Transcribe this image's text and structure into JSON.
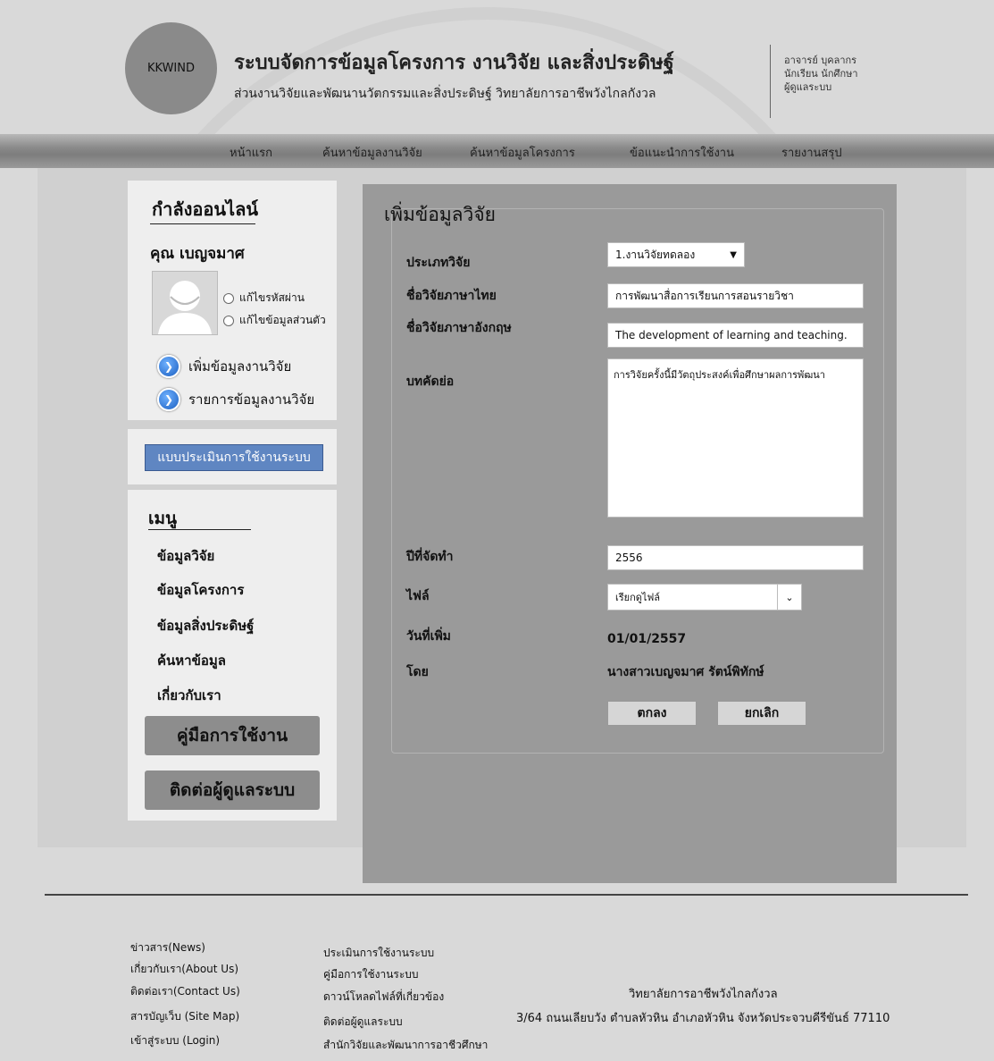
{
  "header": {
    "logo_text": "KKWIND",
    "title": "ระบบจัดการข้อมูลโครงการ งานวิจัย และสิ่งประดิษฐ์",
    "subtitle": "ส่วนงานวิจัยและพัฒนานวัตกรรมและสิ่งประดิษฐ์ วิทยาลัยการอาชีพวังไกลกังวล",
    "roles": [
      "อาจารย์ บุคลากร",
      "นักเรียน นักศึกษา",
      "ผู้ดูแลระบบ"
    ]
  },
  "nav": {
    "items": [
      "หน้าแรก",
      "ค้นหาข้อมูลงานวิจัย",
      "ค้นหาข้อมูลโครงการ",
      "ข้อแนะนำการใช้งาน",
      "รายงานสรุป"
    ]
  },
  "sidebar": {
    "online_title": "กำลังออนไลน์",
    "user_name": "คุณ เบญจมาศ",
    "account_links": [
      "แก้ไขรหัสผ่าน",
      "แก้ไขข้อมูลส่วนตัว"
    ],
    "research_links": [
      "เพิ่มข้อมูลงานวิจัย",
      "รายการข้อมูลงานวิจัย"
    ],
    "evaluation_button": "แบบประเมินการใช้งานระบบ",
    "menu_title": "เมนู",
    "menu_items": [
      "ข้อมูลวิจัย",
      "ข้อมูลโครงการ",
      "ข้อมูลสิ่งประดิษฐ์",
      "ค้นหาข้อมูล",
      "เกี่ยวกับเรา"
    ],
    "manual_button": "คู่มือการใช้งาน",
    "contact_button": "ติดต่อผู้ดูแลระบบ"
  },
  "form": {
    "title": "เพิ่มข้อมูลวิจัย",
    "labels": {
      "type": "ประเภทวิจัย",
      "name_th": "ชื่อวิจัยภาษาไทย",
      "name_en": "ชื่อวิจัยภาษาอังกฤษ",
      "abstract": "บทคัดย่อ",
      "year": "ปีที่จัดทำ",
      "file": "ไฟล์",
      "date_added": "วันที่เพิ่ม",
      "by": "โดย"
    },
    "values": {
      "type": "1.งานวิจัยทดลอง",
      "name_th": "การพัฒนาสื่อการเรียนการสอนรายวิชา",
      "name_en": "The development of learning and teaching.",
      "abstract": "การวิจัยครั้งนี้มีวัตถุประสงค์เพื่อศึกษาผลการพัฒนา",
      "year": "2556",
      "file": "เรียกดูไฟล์",
      "date_added": "01/01/2557",
      "by": "นางสาวเบญจมาศ รัตน์พิทักษ์"
    },
    "submit_label": "ตกลง",
    "cancel_label": "ยกเลิก"
  },
  "footer": {
    "col1": [
      "ข่าวสาร(News)",
      "เกี่ยวกับเรา(About Us)",
      "ติดต่อเรา(Contact Us)",
      "สารบัญเว็บ (Site Map)",
      "เข้าสู่ระบบ (Login)"
    ],
    "col2": [
      "ประเมินการใช้งานระบบ",
      "คู่มือการใช้งานระบบ",
      "ดาวน์โหลดไฟล์ที่เกี่ยวข้อง",
      "ติดต่อผู้ดูแลระบบ",
      "สำนักวิจัยและพัฒนาการอาชีวศึกษา"
    ],
    "org_name": "วิทยาลัยการอาชีพวังไกลกังวล",
    "address": "3/64 ถนนเลียบวัง ตำบลหัวหิน อำเภอหัวหิน จังหวัดประจวบคีรีขันธ์ 77110"
  }
}
